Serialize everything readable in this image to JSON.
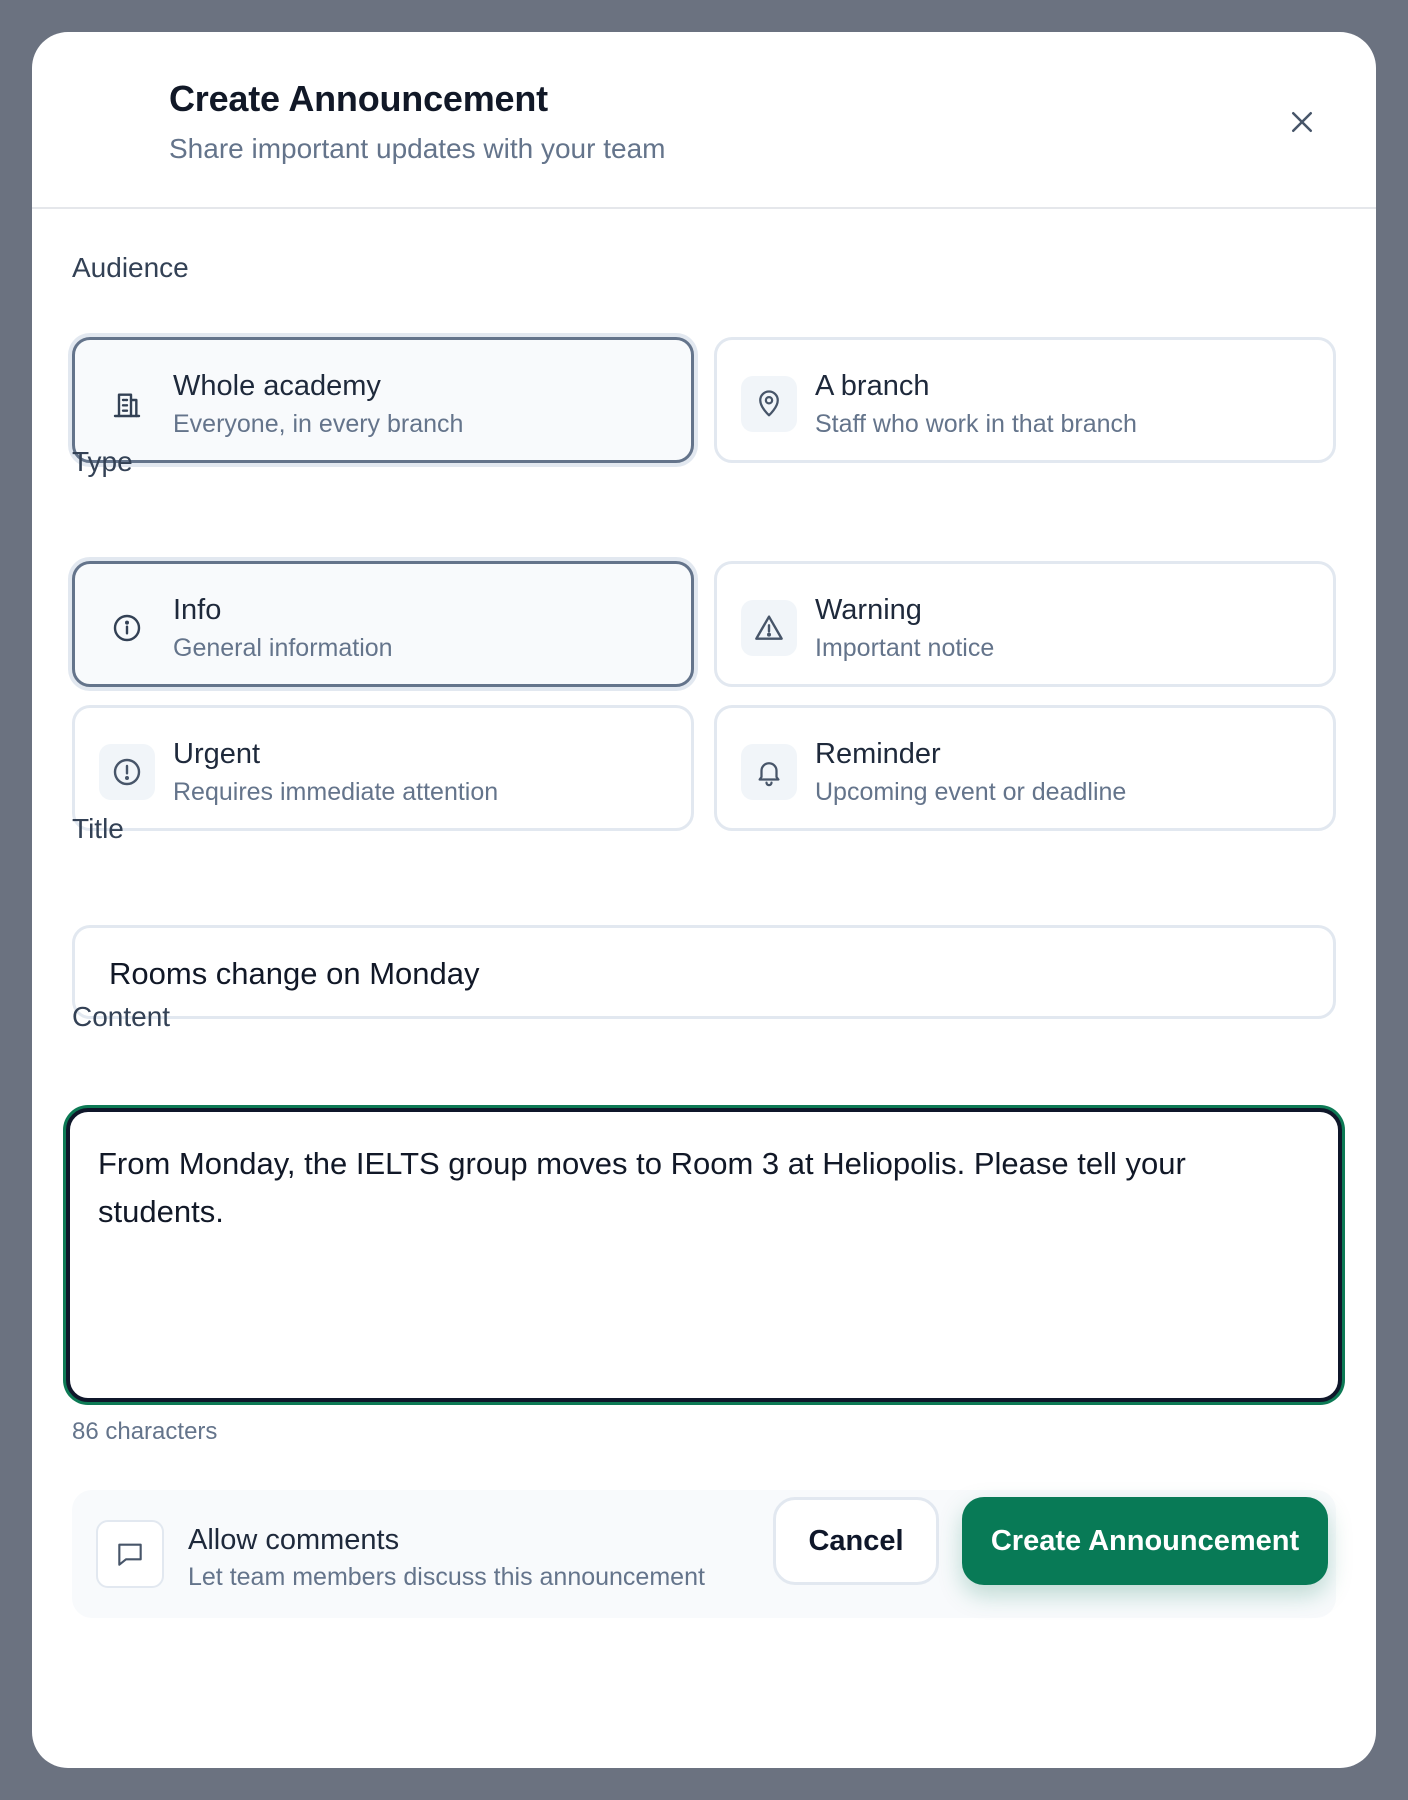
{
  "header": {
    "title": "Create Announcement",
    "subtitle": "Share important updates with your team"
  },
  "audience": {
    "label": "Audience",
    "options": [
      {
        "title": "Whole academy",
        "description": "Everyone, in every branch",
        "icon": "building-icon",
        "selected": true
      },
      {
        "title": "A branch",
        "description": "Staff who work in that branch",
        "icon": "map-pin-icon",
        "selected": false
      }
    ]
  },
  "type": {
    "label": "Type",
    "options": [
      {
        "title": "Info",
        "description": "General information",
        "icon": "info-icon",
        "selected": true
      },
      {
        "title": "Warning",
        "description": "Important notice",
        "icon": "warning-icon",
        "selected": false
      },
      {
        "title": "Urgent",
        "description": "Requires immediate attention",
        "icon": "alert-circle-icon",
        "selected": false
      },
      {
        "title": "Reminder",
        "description": "Upcoming event or deadline",
        "icon": "bell-icon",
        "selected": false
      }
    ]
  },
  "title_field": {
    "label": "Title",
    "value": "Rooms change on Monday"
  },
  "content_field": {
    "label": "Content",
    "value": "From Monday, the IELTS group moves to Room 3 at Heliopolis. Please tell your students.",
    "char_count": "86 characters"
  },
  "comments": {
    "title": "Allow comments",
    "description": "Let team members discuss this announcement",
    "checked": true,
    "icon": "message-square-icon"
  },
  "footer": {
    "cancel_label": "Cancel",
    "create_label": "Create Announcement"
  },
  "colors": {
    "primary": "#087a56",
    "checkbox": "#1a73e8",
    "overlay": "#6b7280"
  }
}
